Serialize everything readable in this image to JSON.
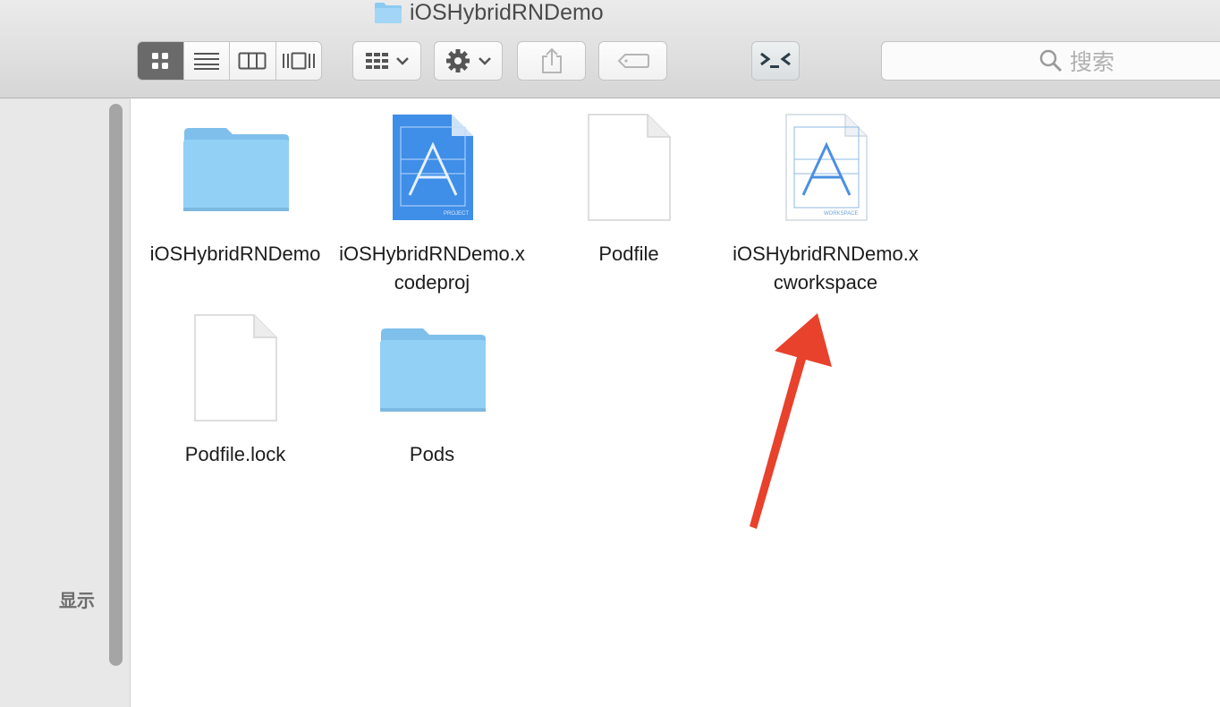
{
  "window": {
    "title": "iOSHybridRNDemo",
    "title_icon": "folder-icon"
  },
  "toolbar": {
    "view_modes": [
      {
        "name": "icon-view",
        "active": true
      },
      {
        "name": "list-view",
        "active": false
      },
      {
        "name": "column-view",
        "active": false
      },
      {
        "name": "coverflow-view",
        "active": false
      }
    ],
    "arrange_icon": "arrange-grid-icon",
    "action_icon": "gear-icon",
    "share_icon": "share-icon",
    "tag_icon": "tag-icon",
    "terminal_icon": "terminal-icon",
    "search_placeholder": "搜索"
  },
  "sidebar": {
    "label": "显示"
  },
  "files": [
    {
      "name": "iOSHybridRNDemo",
      "type": "folder"
    },
    {
      "name": "iOSHybridRNDemo.xcodeproj",
      "type": "xcodeproj",
      "badge": "PROJECT"
    },
    {
      "name": "Podfile",
      "type": "document"
    },
    {
      "name": "iOSHybridRNDemo.xcworkspace",
      "type": "xcworkspace",
      "badge": "WORKSPACE"
    },
    {
      "name": "Podfile.lock",
      "type": "document"
    },
    {
      "name": "Pods",
      "type": "folder"
    }
  ],
  "annotation": {
    "type": "arrow",
    "color": "#e8412c",
    "points_to": "iOSHybridRNDemo.xcworkspace"
  },
  "colors": {
    "folder": "#8ccaf2",
    "project_blue": "#3f8ee8",
    "arrow": "#e8412c"
  }
}
